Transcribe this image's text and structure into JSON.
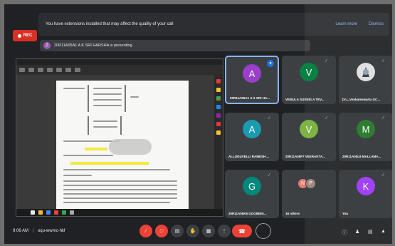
{
  "notification": {
    "text": "You have extensions installed that may affect the quality of your call",
    "learn_more": "Learn more",
    "dismiss": "Dismiss"
  },
  "recording": {
    "label": "REC"
  },
  "presenting": {
    "avatar": "2",
    "text": "20R11A05A1 A K SRI HARSHA is presenting"
  },
  "shared_screen": {
    "window_title": "[document viewer]",
    "highlight_text": "Y = AX(T) + PD",
    "inline_highlight": "Hit Results"
  },
  "participants": [
    {
      "initial": "A",
      "name": "20R11A05A1 A K SRI HA...",
      "color": "#9b3ec9",
      "speaking": true
    },
    {
      "initial": "V",
      "name": "VEMULA SUSEELA TEV...",
      "color": "#0b8043"
    },
    {
      "initial": "",
      "name": "Dr.L.Venkateswarlu GC...",
      "color": "#5f6368"
    },
    {
      "initial": "A",
      "name": "ALLUGUVELLI RAMESH ...",
      "color": "#1a9bb0"
    },
    {
      "initial": "V",
      "name": "20R11A05F7 VEERAKTA...",
      "color": "#7cb342"
    },
    {
      "initial": "M",
      "name": "20R11A05L8 MALLAMA...",
      "color": "#2e7d32"
    },
    {
      "initial": "G",
      "name": "20R11A05K6 GOGINEN...",
      "color": "#00897b"
    },
    {
      "initial": "",
      "name": "16 others",
      "color": ""
    },
    {
      "initial": "K",
      "name": "You",
      "color": "#a142f4"
    }
  ],
  "others_avatars": [
    {
      "initial": "N",
      "color": "#e67c73"
    },
    {
      "initial": "P",
      "color": "#a1887f"
    }
  ],
  "bottom": {
    "time": "9:06 AM",
    "separator": "|",
    "meeting_code": "oqu-wwmc-hkf"
  }
}
